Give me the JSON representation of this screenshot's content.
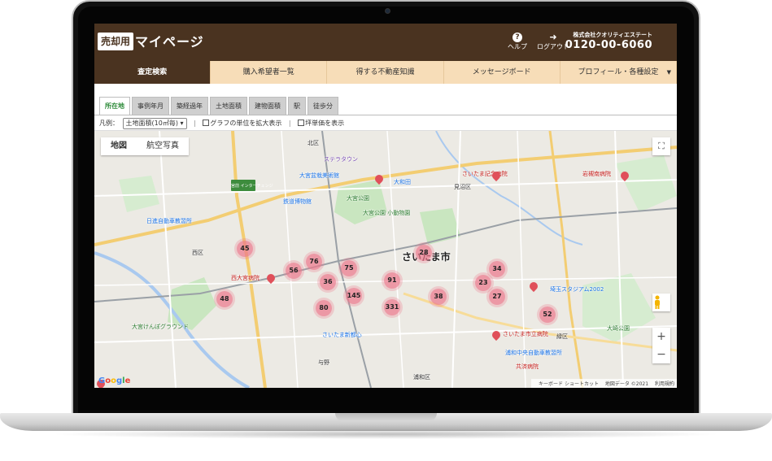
{
  "header": {
    "badge": "売却用",
    "title": "マイページ",
    "help_label": "ヘルプ",
    "logout_label": "ログアウト",
    "company": "株式会社クオリティエステート",
    "phone": "0120-00-6060"
  },
  "nav": {
    "items": [
      {
        "label": "査定検索",
        "active": true
      },
      {
        "label": "購入希望者一覧"
      },
      {
        "label": "得する不動産知識"
      },
      {
        "label": "メッセージボード"
      },
      {
        "label": "プロフィール・各種設定"
      }
    ]
  },
  "subtabs": [
    "所在地",
    "事例年月",
    "築経過年",
    "土地面積",
    "建物面積",
    "駅",
    "徒歩分"
  ],
  "filter": {
    "legend_label": "凡例：",
    "legend_value": "土地面積(10㎡毎)",
    "option1": "グラフの単位を拡大表示",
    "option2": "坪単価を表示"
  },
  "map": {
    "type_map": "地図",
    "type_satellite": "航空写真",
    "city_label": "さいたま市",
    "google_logo": "Google",
    "attribution": [
      "キーボード ショートカット",
      "地図データ ©2021",
      "利用規約"
    ],
    "labels": [
      {
        "t": "北区",
        "k": "ward"
      },
      {
        "t": "見沼区",
        "k": "ward"
      },
      {
        "t": "西区",
        "k": "ward"
      },
      {
        "t": "浦和区",
        "k": "ward"
      },
      {
        "t": "緑区",
        "k": "ward"
      },
      {
        "t": "ステラタウン",
        "k": "poi"
      },
      {
        "t": "大宮盆栽美術館",
        "k": "poi"
      },
      {
        "t": "鉄道博物館",
        "k": "poi"
      },
      {
        "t": "大宮公園",
        "k": "park"
      },
      {
        "t": "大宮公園 小動物園",
        "k": "park"
      },
      {
        "t": "さいたま記念病院",
        "k": "hosp"
      },
      {
        "t": "西大宮病院",
        "k": "hosp"
      },
      {
        "t": "岩槻南病院",
        "k": "hosp"
      },
      {
        "t": "さいたま市立病院",
        "k": "hosp"
      },
      {
        "t": "共済病院",
        "k": "hosp"
      },
      {
        "t": "埼玉スタジアム2002",
        "k": "poi"
      },
      {
        "t": "大宮けんぽグラウンド",
        "k": "park"
      },
      {
        "t": "日進自動車教習所",
        "k": "poi"
      },
      {
        "t": "さいたま新都心",
        "k": "poi"
      },
      {
        "t": "宮前 インターチェンジ",
        "k": "road"
      },
      {
        "t": "大和田",
        "k": "poi"
      },
      {
        "t": "与野",
        "k": "poi"
      },
      {
        "t": "浦和中央自動車教習所",
        "k": "poi"
      },
      {
        "t": "大崎公園",
        "k": "park"
      }
    ],
    "clusters": [
      "45",
      "76",
      "75",
      "28",
      "34",
      "56",
      "36",
      "91",
      "23",
      "27",
      "48",
      "145",
      "38",
      "80",
      "331",
      "52"
    ]
  },
  "colors": {
    "brand": "#4a3320",
    "nav_bg": "#f7ddb8",
    "cluster": "#ec788c"
  }
}
